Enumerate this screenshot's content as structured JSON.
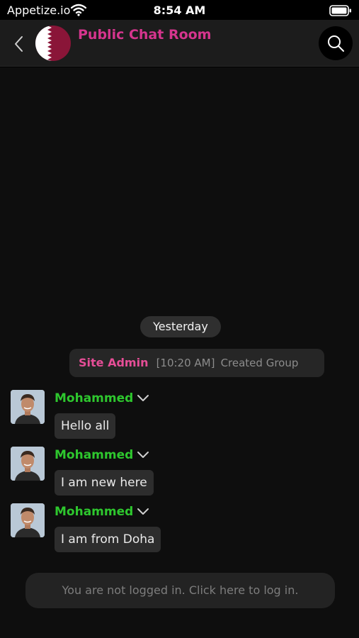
{
  "status_bar": {
    "carrier": "Appetize.io",
    "time": "8:54 AM"
  },
  "header": {
    "title": "Public Chat Room",
    "accent_color": "#d6358e"
  },
  "chat": {
    "date_divider": "Yesterday",
    "system_message": {
      "sender": "Site Admin",
      "time": "[10:20 AM]",
      "text": "Created Group"
    },
    "messages": [
      {
        "sender": "Mohammed",
        "text": "Hello all"
      },
      {
        "sender": "Mohammed",
        "text": "I am new here"
      },
      {
        "sender": "Mohammed",
        "text": "I am from Doha"
      }
    ],
    "sender_color": "#2ec72e"
  },
  "login_banner": {
    "text": "You are not logged in. Click here to log in."
  }
}
